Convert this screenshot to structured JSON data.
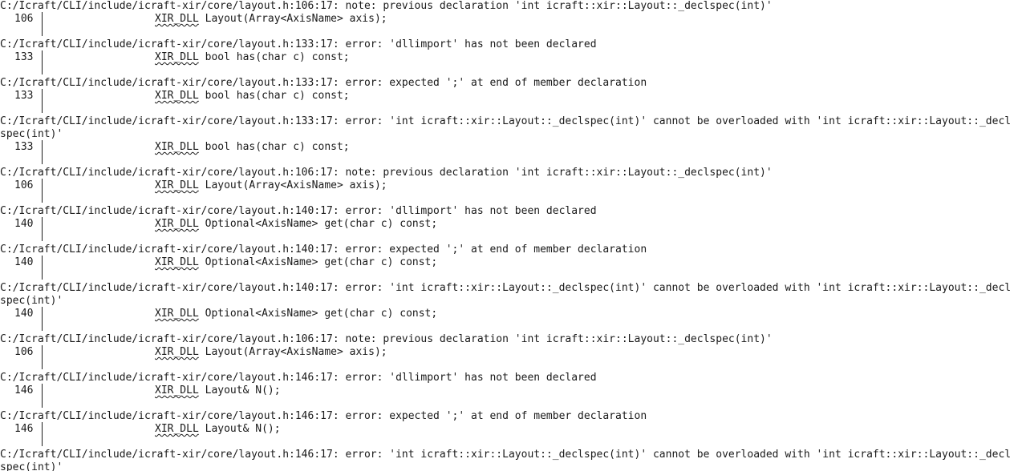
{
  "console": {
    "entries": [
      {
        "header": "C:/Icraft/CLI/include/icraft-xir/core/layout.h:106:17: note: previous declaration 'int icraft::xir::Layout::_declspec(int)'",
        "line_no": "106",
        "macro": "XIR_DLL",
        "code_rest": " Layout(Array<AxisName> axis);"
      },
      {
        "header": "C:/Icraft/CLI/include/icraft-xir/core/layout.h:133:17: error: 'dllimport' has not been declared",
        "line_no": "133",
        "macro": "XIR_DLL",
        "code_rest": " bool has(char c) const;"
      },
      {
        "header": "C:/Icraft/CLI/include/icraft-xir/core/layout.h:133:17: error: expected ';' at end of member declaration",
        "line_no": "133",
        "macro": "XIR_DLL",
        "code_rest": " bool has(char c) const;"
      },
      {
        "header": "C:/Icraft/CLI/include/icraft-xir/core/layout.h:133:17: error: 'int icraft::xir::Layout::_declspec(int)' cannot be overloaded with 'int icraft::xir::Layout::_declspec(int)'",
        "line_no": "133",
        "macro": "XIR_DLL",
        "code_rest": " bool has(char c) const;"
      },
      {
        "header": "C:/Icraft/CLI/include/icraft-xir/core/layout.h:106:17: note: previous declaration 'int icraft::xir::Layout::_declspec(int)'",
        "line_no": "106",
        "macro": "XIR_DLL",
        "code_rest": " Layout(Array<AxisName> axis);"
      },
      {
        "header": "C:/Icraft/CLI/include/icraft-xir/core/layout.h:140:17: error: 'dllimport' has not been declared",
        "line_no": "140",
        "macro": "XIR_DLL",
        "code_rest": " Optional<AxisName> get(char c) const;"
      },
      {
        "header": "C:/Icraft/CLI/include/icraft-xir/core/layout.h:140:17: error: expected ';' at end of member declaration",
        "line_no": "140",
        "macro": "XIR_DLL",
        "code_rest": " Optional<AxisName> get(char c) const;"
      },
      {
        "header": "C:/Icraft/CLI/include/icraft-xir/core/layout.h:140:17: error: 'int icraft::xir::Layout::_declspec(int)' cannot be overloaded with 'int icraft::xir::Layout::_declspec(int)'",
        "line_no": "140",
        "macro": "XIR_DLL",
        "code_rest": " Optional<AxisName> get(char c) const;"
      },
      {
        "header": "C:/Icraft/CLI/include/icraft-xir/core/layout.h:106:17: note: previous declaration 'int icraft::xir::Layout::_declspec(int)'",
        "line_no": "106",
        "macro": "XIR_DLL",
        "code_rest": " Layout(Array<AxisName> axis);"
      },
      {
        "header": "C:/Icraft/CLI/include/icraft-xir/core/layout.h:146:17: error: 'dllimport' has not been declared",
        "line_no": "146",
        "macro": "XIR_DLL",
        "code_rest": " Layout& N();"
      },
      {
        "header": "C:/Icraft/CLI/include/icraft-xir/core/layout.h:146:17: error: expected ';' at end of member declaration",
        "line_no": "146",
        "macro": "XIR_DLL",
        "code_rest": " Layout& N();"
      },
      {
        "header": "C:/Icraft/CLI/include/icraft-xir/core/layout.h:146:17: error: 'int icraft::xir::Layout::_declspec(int)' cannot be overloaded with 'int icraft::xir::Layout::_declspec(int)'",
        "line_no": "",
        "macro": "",
        "code_rest": ""
      }
    ]
  }
}
